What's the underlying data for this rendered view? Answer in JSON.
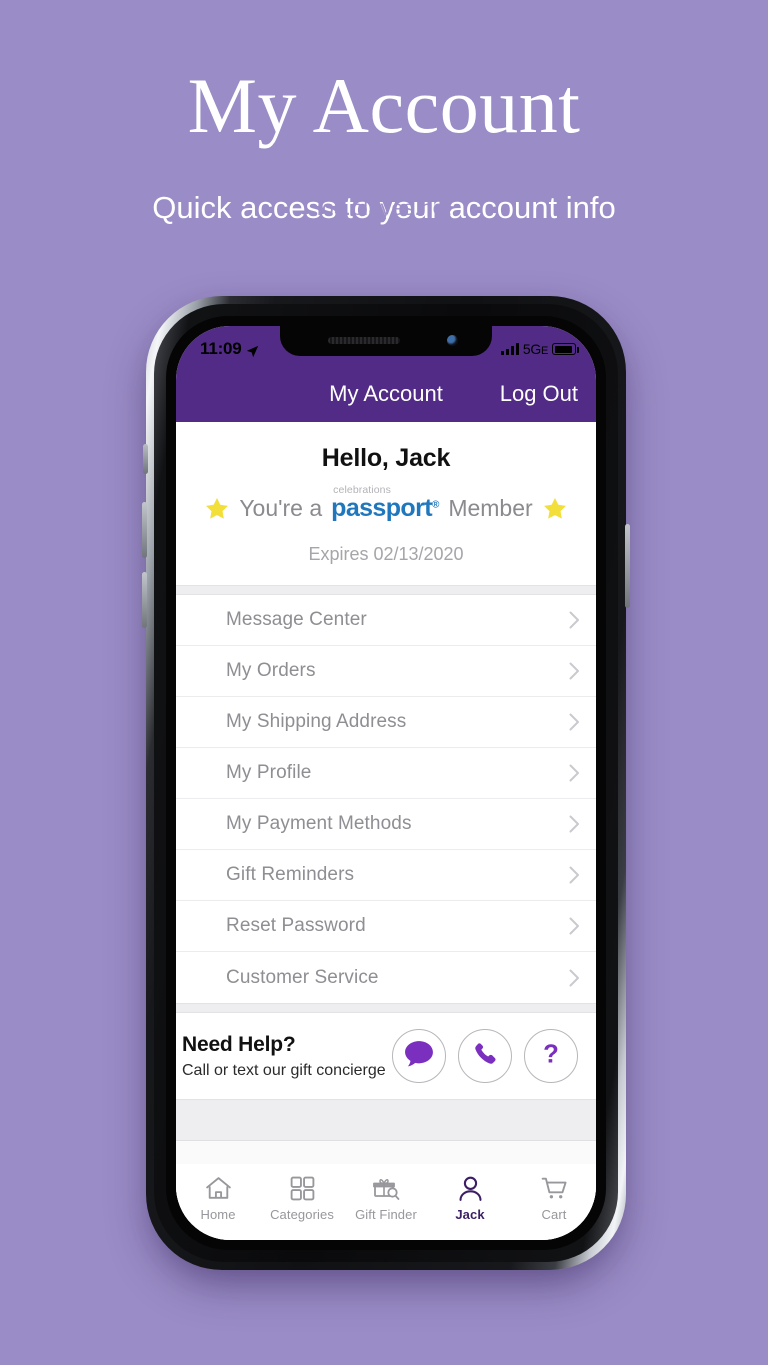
{
  "promo": {
    "title": "My Account",
    "subtitle": "Quick access to your account info",
    "watermark": "ios.playes.net"
  },
  "colors": {
    "page_background": "#9a8cc6",
    "brand_purple": "#512b85",
    "passport_blue": "#1f77bd",
    "star_yellow": "#f2df3a",
    "row_text": "#8e8e93",
    "band_gray": "#eeeef0"
  },
  "status_bar": {
    "time": "11:09",
    "location_icon": "location-arrow-icon",
    "signal_icon": "signal-bars-icon",
    "network": "5G",
    "network_suffix": "E",
    "battery_icon": "battery-icon"
  },
  "navbar": {
    "title": "My Account",
    "action_label": "Log Out"
  },
  "account": {
    "greeting": "Hello, Jack",
    "member_prefix": "You're a",
    "brand_small": "celebrations",
    "brand_main": "passport",
    "brand_registered": "®",
    "member_suffix": "Member",
    "expires": "Expires 02/13/2020",
    "left_star_icon": "star-icon",
    "right_star_icon": "star-icon"
  },
  "menu": {
    "items": [
      {
        "label": "Message Center",
        "chevron": "chevron-right-icon"
      },
      {
        "label": "My Orders",
        "chevron": "chevron-right-icon"
      },
      {
        "label": "My Shipping Address",
        "chevron": "chevron-right-icon"
      },
      {
        "label": "My Profile",
        "chevron": "chevron-right-icon"
      },
      {
        "label": "My Payment Methods",
        "chevron": "chevron-right-icon"
      },
      {
        "label": "Gift Reminders",
        "chevron": "chevron-right-icon"
      },
      {
        "label": "Reset Password",
        "chevron": "chevron-right-icon"
      },
      {
        "label": "Customer Service",
        "chevron": "chevron-right-icon"
      }
    ]
  },
  "help": {
    "title": "Need Help?",
    "subtitle": "Call or text our gift concierge",
    "buttons": [
      {
        "name": "chat-bubble-icon"
      },
      {
        "name": "phone-icon"
      },
      {
        "name": "question-mark-icon"
      }
    ]
  },
  "tabbar": {
    "tabs": [
      {
        "label": "Home",
        "icon": "home-icon",
        "active": false
      },
      {
        "label": "Categories",
        "icon": "grid-icon",
        "active": false
      },
      {
        "label": "Gift Finder",
        "icon": "gift-search-icon",
        "active": false
      },
      {
        "label": "Jack",
        "icon": "person-icon",
        "active": true
      },
      {
        "label": "Cart",
        "icon": "cart-icon",
        "active": false
      }
    ]
  }
}
